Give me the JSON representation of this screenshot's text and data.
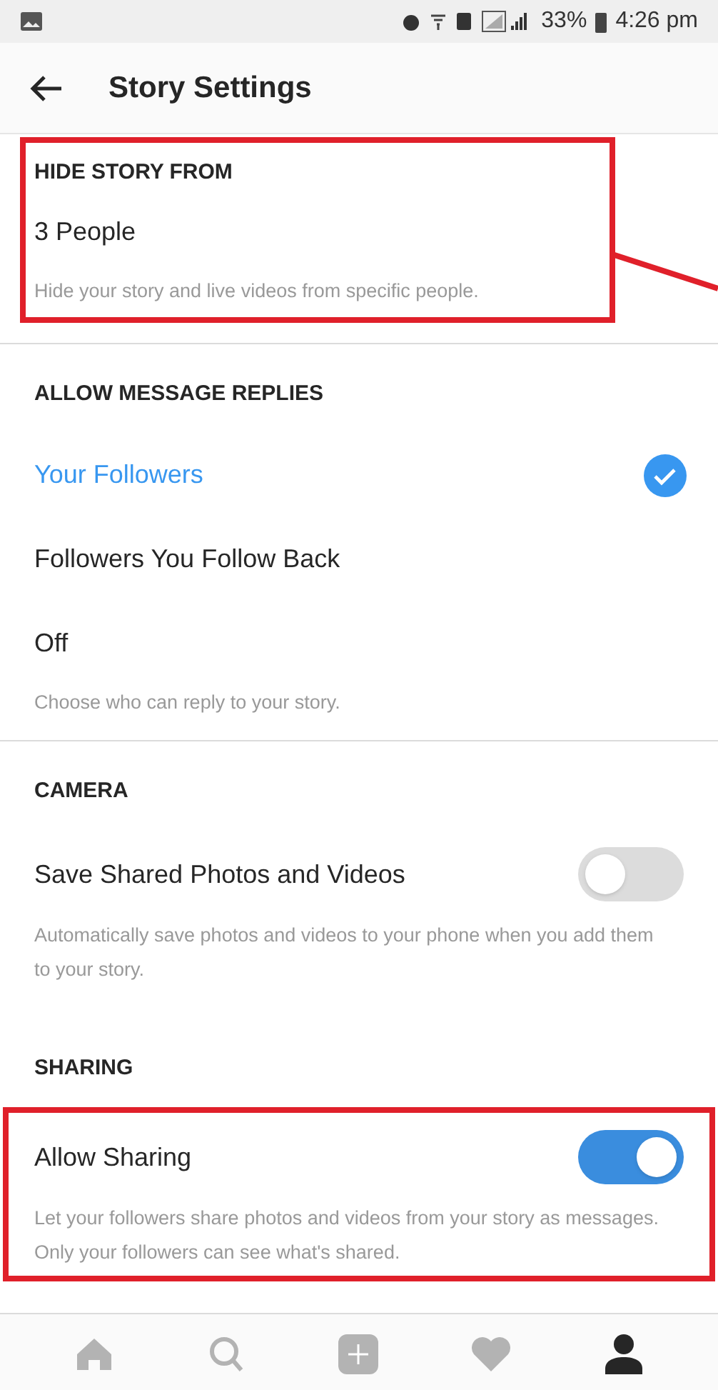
{
  "status_bar": {
    "battery": "33%",
    "time": "4:26 pm"
  },
  "header": {
    "title": "Story Settings"
  },
  "sections": [
    {
      "header": "HIDE STORY FROM",
      "highlighted": true,
      "body_highlighted": false,
      "divider": true,
      "items": [
        {
          "kind": "link",
          "label": "3 People"
        }
      ],
      "note": "Hide your story and live videos from specific people."
    },
    {
      "header": "ALLOW MESSAGE REPLIES",
      "highlighted": false,
      "body_highlighted": false,
      "divider": true,
      "items": [
        {
          "kind": "option",
          "label": "Your Followers",
          "selected": true
        },
        {
          "kind": "option",
          "label": "Followers You Follow Back",
          "selected": false
        },
        {
          "kind": "option",
          "label": "Off",
          "selected": false
        }
      ],
      "note": "Choose who can reply to your story."
    },
    {
      "header": "CAMERA",
      "highlighted": false,
      "body_highlighted": false,
      "divider": false,
      "items": [
        {
          "kind": "toggle",
          "label": "Save Shared Photos and Videos",
          "on": false
        }
      ],
      "note": "Automatically save photos and videos to your phone when you add them to your story."
    },
    {
      "header": "SHARING",
      "highlighted": false,
      "body_highlighted": true,
      "divider": false,
      "items": [
        {
          "kind": "toggle",
          "label": "Allow Sharing",
          "on": true
        }
      ],
      "note": "Let your followers share photos and videos from your story as messages. Only your followers can see what's shared."
    }
  ],
  "nav": [
    {
      "selected": false
    },
    {
      "selected": false
    },
    {
      "selected": false
    },
    {
      "selected": false
    },
    {
      "selected": true
    }
  ]
}
